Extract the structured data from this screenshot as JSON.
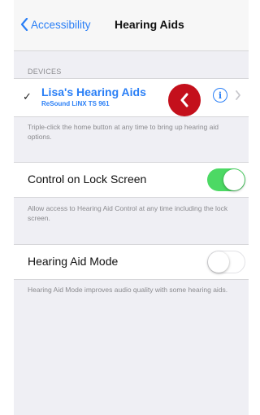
{
  "nav": {
    "back_label": "Accessibility",
    "title": "Hearing Aids"
  },
  "devices": {
    "header": "DEVICES",
    "device_name": "Lisa's Hearing Aids",
    "device_model": "ReSound LiNX TS 961",
    "checked": true,
    "footer": "Triple-click the home button at any time to bring up hearing aid options."
  },
  "control_lock": {
    "label": "Control on Lock Screen",
    "enabled": true,
    "footer": "Allow access to Hearing Aid Control at any time including the lock screen."
  },
  "hearing_mode": {
    "label": "Hearing Aid Mode",
    "enabled": false,
    "footer": "Hearing Aid Mode improves audio quality with some hearing aids."
  },
  "colors": {
    "accent": "#2a7ff6",
    "toggle_on": "#4cd964",
    "badge": "#c4101c",
    "background": "#efeff4"
  },
  "icons": {
    "back": "chevron-left-icon",
    "check": "checkmark-icon",
    "badge": "chevron-left-icon",
    "info": "info-icon",
    "disclosure": "chevron-right-icon"
  }
}
